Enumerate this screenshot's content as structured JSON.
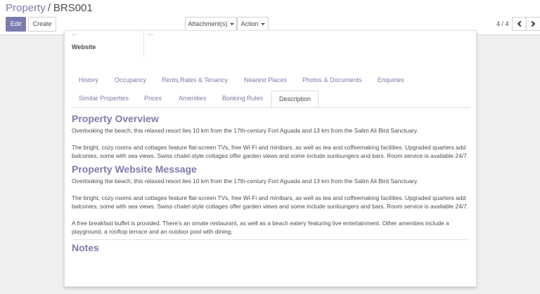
{
  "breadcrumb": {
    "parent": "Property",
    "separator": "/",
    "current": "BRS001"
  },
  "toolbar": {
    "edit_label": "Edit",
    "create_label": "Create",
    "attachments_label": "Attachment(s)",
    "action_label": "Action"
  },
  "pager": {
    "value": "4 / 4"
  },
  "form": {
    "website_label": "Website",
    "cut_label_left": "...",
    "cut_value_right": "..."
  },
  "tabs": {
    "row1": [
      "History",
      "Occupancy",
      "Rents,Rates & Tenancy",
      "Nearest Places",
      "Photos & Documents",
      "Enquiries"
    ],
    "row2": [
      "Similar Properties",
      "Prices",
      "Amenities",
      "Booking Rules",
      "Description"
    ],
    "active": "Description"
  },
  "description": {
    "overview_heading": "Property Overview",
    "overview_p1": "Overlooking the beach, this relaxed resort lies 10 km from the 17th-century Fort Aguada and 13 km from the Salim Ali Bird Sanctuary.",
    "overview_p2": "The bright, cozy rooms and cottages feature flat-screen TVs, free Wi-Fi and minibars, as well as tea and coffeemaking facilities. Upgraded quarters add balconies, some with sea views. Swiss chalet-style cottages offer garden views and some include sunloungers and bars. Room service is available 24/7.",
    "website_heading": "Property Website Message",
    "website_p1": "Overlooking the beach, this relaxed resort lies 10 km from the 17th-century Fort Aguada and 13 km from the Salim Ali Bird Sanctuary.",
    "website_p2": "The bright, cozy rooms and cottages feature flat-screen TVs, free Wi-Fi and minibars, as well as tea and coffeemaking facilities. Upgraded quarters add balconies, some with sea views. Swiss chalet-style cottages offer garden views and some include sunloungers and bars. Room service is available 24/7.",
    "website_p3": "A free breakfast buffet is provided. There's an ornate restaurant, as well as a beach eatery featuring live entertainment. Other amenities include a playground, a rooftop terrace and an outdoor pool with dining.",
    "notes_heading": "Notes"
  },
  "colors": {
    "brand": "#7c7bad",
    "text": "#4c4c4c",
    "background": "#f0f0f0"
  }
}
